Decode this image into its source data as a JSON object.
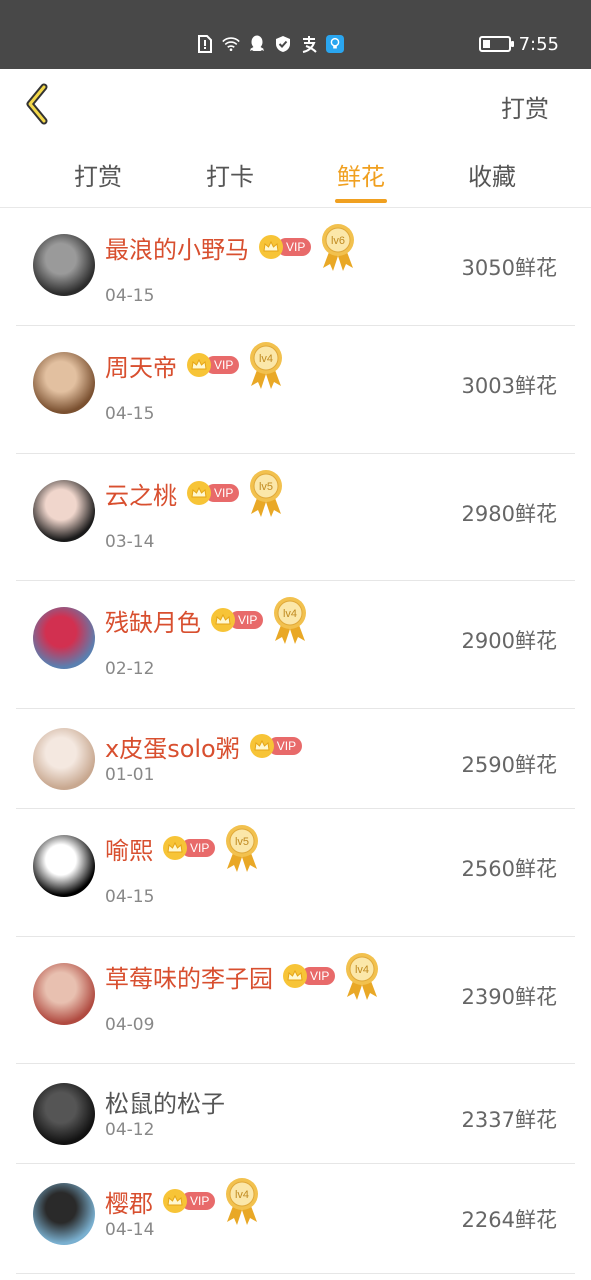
{
  "status_bar": {
    "time": "7:55",
    "battery_level": 0.3,
    "icons": [
      "sim-alert-icon",
      "wifi-icon",
      "qq-icon",
      "shield-icon",
      "alipay-icon",
      "bulb-app-icon"
    ]
  },
  "header": {
    "action_label": "打赏"
  },
  "tabs": [
    {
      "label": "打赏",
      "active": false
    },
    {
      "label": "打卡",
      "active": false
    },
    {
      "label": "鲜花",
      "active": true
    },
    {
      "label": "收藏",
      "active": false
    }
  ],
  "colors": {
    "accent": "#f0a020",
    "vip_name": "#d84f2f",
    "vip_pill": "#e86a6a",
    "crown": "#f7c437",
    "status_bar": "#484848"
  },
  "rows": [
    {
      "name": "最浪的小野马",
      "date": "04-15",
      "amount": "3050鲜花",
      "vip": true,
      "level": "lv6"
    },
    {
      "name": "周天帝",
      "date": "04-15",
      "amount": "3003鲜花",
      "vip": true,
      "level": "lv4"
    },
    {
      "name": "云之桃",
      "date": "03-14",
      "amount": "2980鲜花",
      "vip": true,
      "level": "lv5"
    },
    {
      "name": "残缺月色",
      "date": "02-12",
      "amount": "2900鲜花",
      "vip": true,
      "level": "lv4"
    },
    {
      "name": "x皮蛋solo粥",
      "date": "01-01",
      "amount": "2590鲜花",
      "vip": true,
      "level": ""
    },
    {
      "name": "喻熙",
      "date": "04-15",
      "amount": "2560鲜花",
      "vip": true,
      "level": "lv5"
    },
    {
      "name": "草莓味的李子园",
      "date": "04-09",
      "amount": "2390鲜花",
      "vip": true,
      "level": "lv4"
    },
    {
      "name": "松鼠的松子",
      "date": "04-12",
      "amount": "2337鲜花",
      "vip": false,
      "level": ""
    },
    {
      "name": "樱郡",
      "date": "04-14",
      "amount": "2264鲜花",
      "vip": true,
      "level": "lv4"
    }
  ],
  "vip_label": "VIP"
}
